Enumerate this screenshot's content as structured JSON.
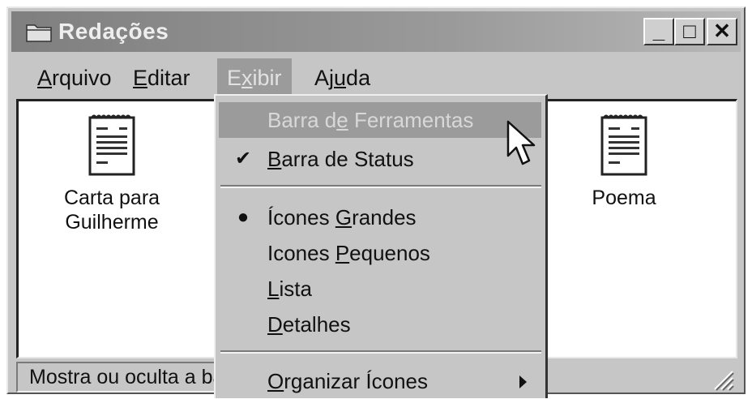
{
  "window": {
    "title": "Redações",
    "buttons": {
      "minimize": "_",
      "maximize": "□",
      "close": "✕"
    }
  },
  "menubar": {
    "items": [
      {
        "label": "Arquivo",
        "access": "A",
        "rest": "rquivo"
      },
      {
        "label": "Editar",
        "access": "E",
        "rest": "ditar"
      },
      {
        "label": "Exibir",
        "pre": "E",
        "access": "x",
        "rest": "ibir"
      },
      {
        "label": "Ajuda",
        "pre": "Aj",
        "access": "u",
        "rest": "da"
      }
    ]
  },
  "files": [
    {
      "name_line1": "Carta para",
      "name_line2": "Guilherme",
      "icon": "document-icon"
    },
    {
      "name_line1": "Poema",
      "name_line2": "",
      "icon": "document-icon"
    }
  ],
  "view_menu": {
    "items": [
      {
        "pre": "Barra d",
        "access": "e",
        "rest": " Ferramentas",
        "mark": "",
        "highlighted": true
      },
      {
        "pre": "",
        "access": "B",
        "rest": "arra de Status",
        "mark": "✔",
        "highlighted": false
      },
      {
        "pre": "Ícones ",
        "access": "G",
        "rest": "randes",
        "mark": "●",
        "highlighted": false
      },
      {
        "pre": "Icones ",
        "access": "P",
        "rest": "equenos",
        "mark": "",
        "highlighted": false
      },
      {
        "pre": "",
        "access": "L",
        "rest": "ista",
        "mark": "",
        "highlighted": false
      },
      {
        "pre": "",
        "access": "D",
        "rest": "etalhes",
        "mark": "",
        "highlighted": false
      },
      {
        "pre": "",
        "access": "O",
        "rest": "rganizar Ícones",
        "mark": "",
        "highlighted": false,
        "submenu": true
      }
    ]
  },
  "status": {
    "text": "Mostra ou oculta a barra de ferramentas"
  },
  "colors": {
    "titlebar": "#8a8a8a",
    "face": "#c6c6c6",
    "highlight": "#9b9b9b"
  }
}
